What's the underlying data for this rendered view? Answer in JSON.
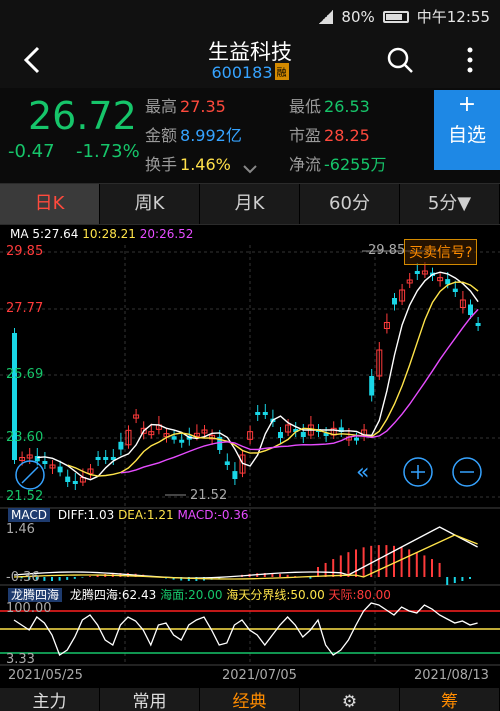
{
  "status": {
    "battery": "80%",
    "time": "中午12:55"
  },
  "header": {
    "title": "生益科技",
    "code": "600183",
    "code_tag": "融"
  },
  "quote": {
    "price": "26.72",
    "change": "-0.47",
    "change_pct": "-1.73%",
    "high_k": "最高",
    "high_v": "27.35",
    "low_k": "最低",
    "low_v": "26.53",
    "amount_k": "金额",
    "amount_v": "8.992亿",
    "pe_k": "市盈",
    "pe_v": "28.25",
    "turnover_k": "换手",
    "turnover_v": "1.46%",
    "netflow_k": "净流",
    "netflow_v": "-6255万",
    "watch_plus": "+",
    "watch_label": "自选"
  },
  "tabs": [
    "日K",
    "周K",
    "月K",
    "60分",
    "5分▼"
  ],
  "chart": {
    "ma": {
      "ma5": "MA 5:27.64",
      "ma10": "10:28.21",
      "ma20": "20:26.52"
    },
    "y_top": "29.85",
    "y_2": "27.77",
    "y_3": "25.69",
    "y_4": "23.60",
    "y_bot": "21.52",
    "max_marker": "29.85",
    "min_marker": "21.52",
    "signal": "买卖信号?",
    "macd": {
      "name": "MACD",
      "diff": "DIFF:1.03",
      "dea": "DEA:1.21",
      "macd": "MACD:-0.36",
      "top": "1.46",
      "bot": "-0.36"
    },
    "lt": {
      "name": "龙腾四海",
      "value": "龙腾四海:62.43",
      "sea": "海面:20.00",
      "mid": "海天分界线:50.00",
      "sky": "天际:80.00",
      "top": "100.00",
      "bot": "3.33"
    },
    "dates": [
      "2021/05/25",
      "2021/07/05",
      "2021/08/13"
    ]
  },
  "bottom_tabs": [
    "主力",
    "常用",
    "经典",
    "⚙",
    "筹"
  ],
  "colors": {
    "up": "#ff3b3b",
    "down": "#19d6e6",
    "green": "#16c56a",
    "blue": "#1e88e5",
    "orange": "#ff8c00"
  }
}
